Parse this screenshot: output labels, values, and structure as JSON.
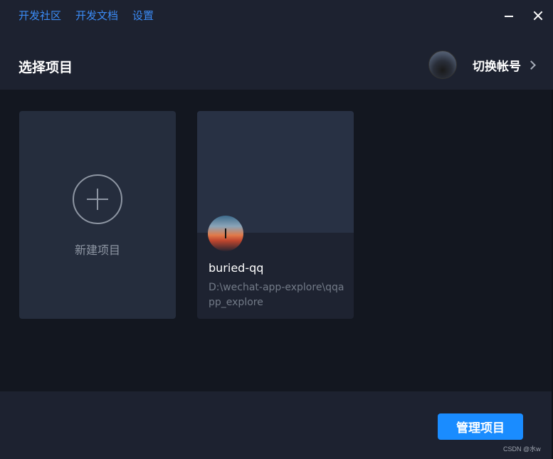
{
  "nav": {
    "links": [
      "开发社区",
      "开发文档",
      "设置"
    ]
  },
  "window_controls": {
    "minimize_icon": "minimize-icon",
    "close_icon": "close-icon"
  },
  "header": {
    "title": "选择项目",
    "switch_account_label": "切换帐号",
    "chevron_icon": "chevron-right-icon"
  },
  "projects": {
    "new_project_label": "新建项目",
    "plus_icon": "plus-circle-icon",
    "items": [
      {
        "name": "buried-qq",
        "path": "D:\\wechat-app-explore\\qqapp_explore"
      }
    ]
  },
  "footer": {
    "manage_label": "管理项目",
    "watermark": "CSDN @水w"
  },
  "colors": {
    "accent": "#1a8cff",
    "link": "#3b8bf5",
    "background": "#1d2230",
    "main_background": "#131720",
    "card": "#252d3d"
  }
}
